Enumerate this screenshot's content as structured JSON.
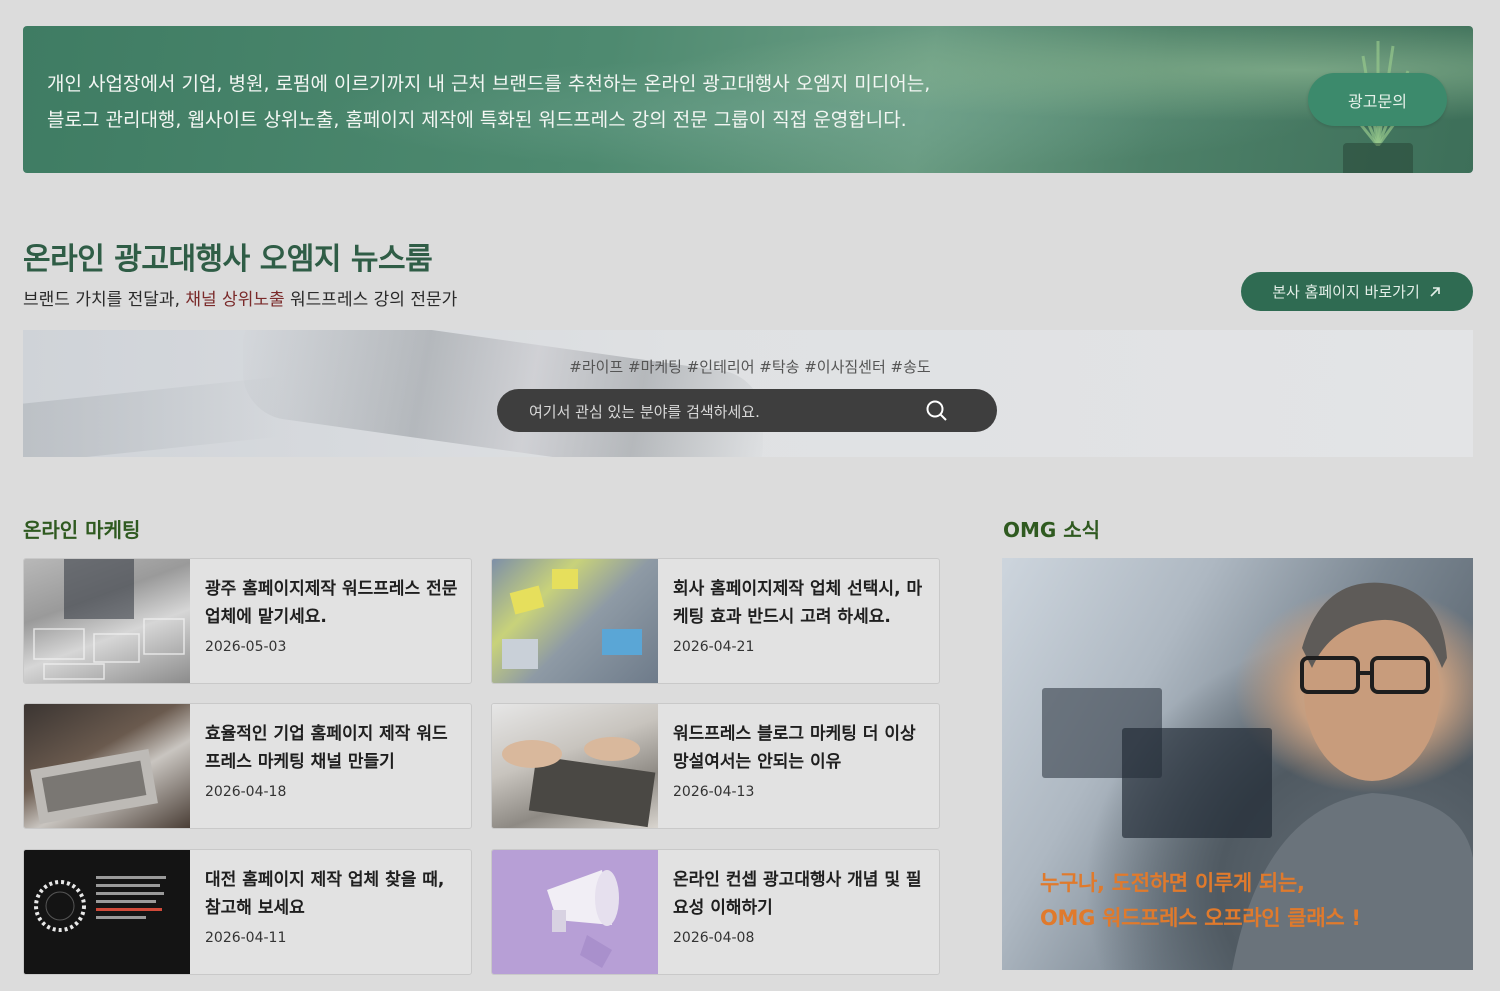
{
  "banner": {
    "line1": "개인 사업장에서 기업, 병원, 로펌에 이르기까지 내 근처 브랜드를 추천하는 온라인 광고대행사 오엠지 미디어는,",
    "line2": "블로그 관리대행, 웹사이트 상위노출, 홈페이지 제작에 특화된 워드프레스 강의 전문 그룹이 직접 운영합니다.",
    "button_label": "광고문의"
  },
  "newsroom": {
    "title": "온라인 광고대행사 오엠지 뉴스룸",
    "subtitle_pre": "브랜드 가치를 전달과, ",
    "subtitle_highlight": "채널 상위노출",
    "subtitle_post": " 워드프레스 강의 전문가",
    "hq_button_label": "본사 홈페이지 바로가기",
    "hq_button_icon": "arrow-up-right-icon"
  },
  "search": {
    "hashtags": "#라이프 #마케팅 #인테리어 #탁송 #이사짐센터 #송도",
    "placeholder": "여기서 관심 있는 분야를 검색하세요.",
    "icon": "search-icon"
  },
  "marketing": {
    "title": "온라인 마케팅",
    "posts": [
      {
        "title": "광주 홈페이지제작 워드프레스 전문 업체에 맡기세요.",
        "date": "2026-05-03"
      },
      {
        "title": "회사 홈페이지제작 업체 선택시, 마케팅 효과 반드시 고려 하세요.",
        "date": "2026-04-21"
      },
      {
        "title": "효율적인 기업 홈페이지 제작 워드프레스 마케팅 채널 만들기",
        "date": "2026-04-18"
      },
      {
        "title": "워드프레스 블로그 마케팅 더 이상 망설여서는 안되는 이유",
        "date": "2026-04-13"
      },
      {
        "title": "대전 홈페이지 제작 업체 찾을 때, 참고해 보세요",
        "date": "2026-04-11"
      },
      {
        "title": "온라인 컨셉 광고대행사 개념 및 필요성 이해하기",
        "date": "2026-04-08"
      }
    ]
  },
  "news": {
    "title": "OMG 소식",
    "caption_line1": "누구나, 도전하면 이루게 되는,",
    "caption_line2": "OMG 워드프레스 오프라인 클래스 !"
  },
  "colors": {
    "brand_green": "#2f6b52",
    "section_title": "#2f5a20",
    "accent_orange": "#e07a2c",
    "highlight_red": "#7a2a2a"
  }
}
